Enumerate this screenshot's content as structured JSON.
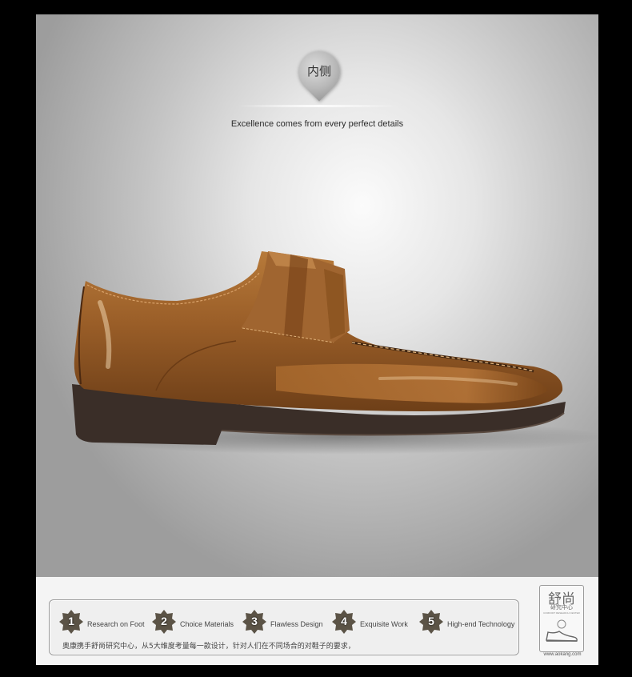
{
  "section": {
    "pin_label": "内侧",
    "tagline": "Excellence comes from every perfect details"
  },
  "features": [
    {
      "num": "1",
      "label": "Research on Foot"
    },
    {
      "num": "2",
      "label": "Choice Materials"
    },
    {
      "num": "3",
      "label": "Flawless Design"
    },
    {
      "num": "4",
      "label": "Exquisite Work"
    },
    {
      "num": "5",
      "label": "High-end Technology"
    }
  ],
  "description": "奥康携手舒尚研究中心，从5大维度考量每一款设计，针对人们在不同场合的对鞋子的要求，",
  "logo": {
    "big": "舒尚",
    "small": "研究中心",
    "tiny": "COMFORT RESEARCH CENTER",
    "url": "www.aokang.com"
  },
  "colors": {
    "leather": "#9a5e28",
    "sole": "#3a2e28",
    "badge": "#5b5346"
  }
}
